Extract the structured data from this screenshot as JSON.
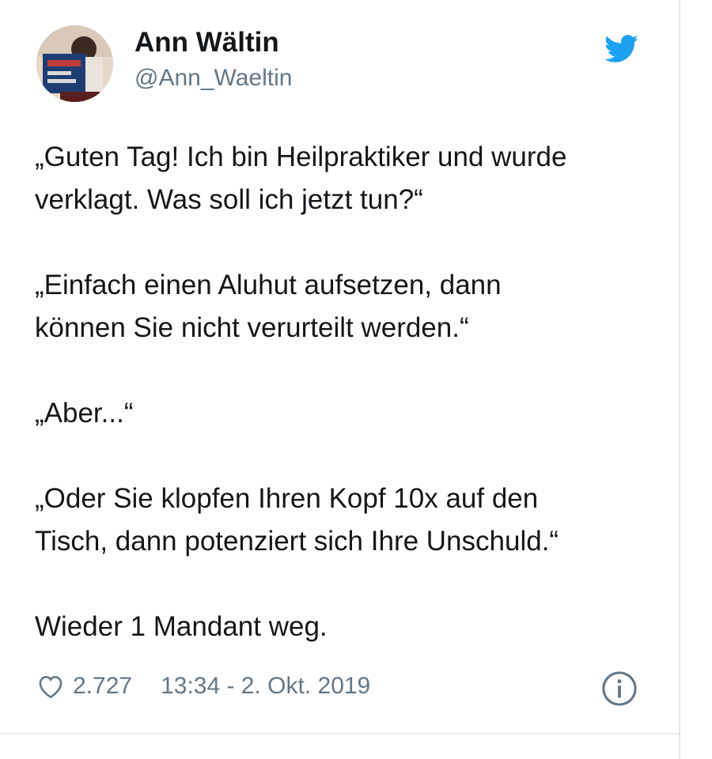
{
  "tweet": {
    "author_name": "Ann Wältin",
    "author_handle": "@Ann_Waeltin",
    "paragraphs": [
      "„Guten Tag! Ich bin Heilpraktiker und wurde\nverklagt. Was soll ich jetzt tun?“",
      "„Einfach einen Aluhut aufsetzen, dann\nkönnen Sie nicht verurteilt werden.“",
      "„Aber...“",
      "„Oder Sie klopfen Ihren Kopf 10x auf den\nTisch, dann potenziert sich Ihre Unschuld.“",
      "Wieder 1 Mandant weg."
    ],
    "likes": "2.727",
    "timestamp": "13:34 - 2. Okt. 2019"
  },
  "icons": {
    "brand": "twitter-bird-icon",
    "like": "heart-icon",
    "info": "info-icon"
  },
  "colors": {
    "brand_blue": "#1da1f2",
    "text_primary": "#14171a",
    "text_secondary": "#657786"
  }
}
